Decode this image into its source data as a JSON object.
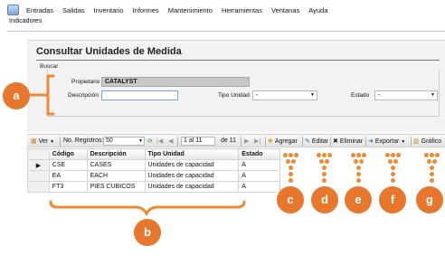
{
  "menu": {
    "items": [
      "Entradas",
      "Salidas",
      "Inventario",
      "Informes",
      "Mantenimiento",
      "Herramientas",
      "Ventanas",
      "Ayuda"
    ],
    "submenu": "Indicadores"
  },
  "page": {
    "title": "Consultar Unidades de Medida",
    "group_label": "Buscar"
  },
  "filters": {
    "propietario_label": "Propietario",
    "propietario_value": "CATALYST",
    "descripcion_label": "Descripción",
    "descripcion_value": "",
    "tipo_unidad_label": "Tipo Unidad",
    "tipo_unidad_value": "-",
    "estado_label": "Estado",
    "estado_value": "-"
  },
  "toolbar": {
    "ver_label": "Ver",
    "registros_label": "No. Registros:",
    "registros_value": "50",
    "page_value": "1 al 11",
    "page_total": "de 11",
    "agregar_label": "Agregar",
    "editar_label": "Editar",
    "eliminar_label": "Eliminar",
    "exportar_label": "Exportar",
    "grafico_label": "Gráfico"
  },
  "grid": {
    "columns": [
      "Código",
      "Descripción",
      "Tipo Unidad",
      "Estado"
    ],
    "rows": [
      [
        "CSE",
        "CASES",
        "Unidades de capacidad",
        "A"
      ],
      [
        "EA",
        "EACH",
        "Unidades de capacidad",
        "A"
      ],
      [
        "FT3",
        "PIES CUBICOS",
        "Unidades de capacidad",
        "A"
      ]
    ],
    "current_row_marker": "▶"
  },
  "callouts": {
    "a": "a",
    "b": "b",
    "c": "c",
    "d": "d",
    "e": "e",
    "f": "f",
    "g": "g",
    "color": "#e8772e"
  }
}
